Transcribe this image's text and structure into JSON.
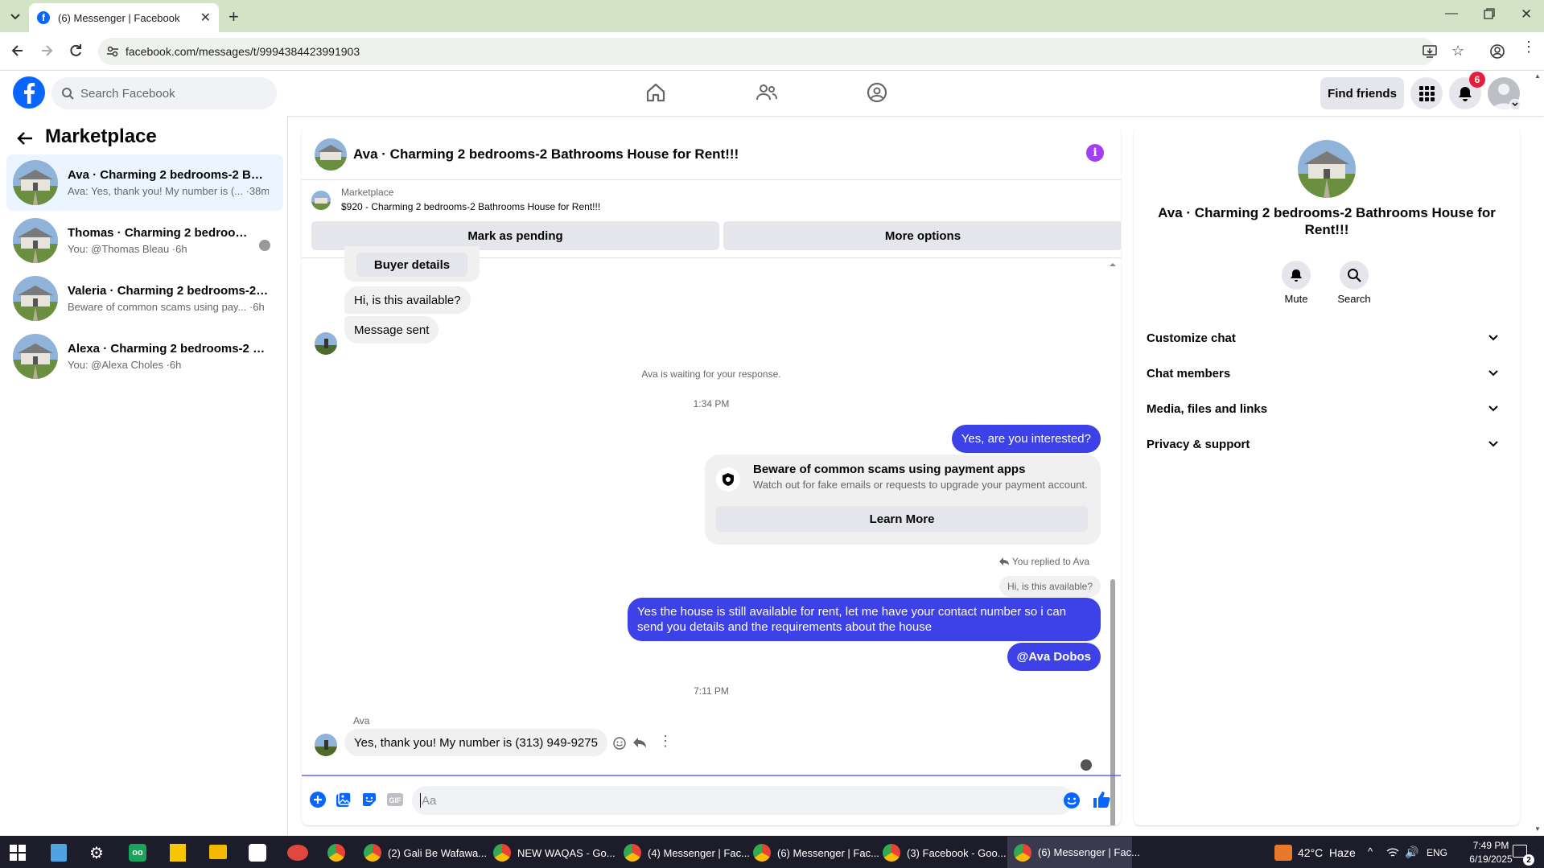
{
  "browser": {
    "tab_title": "(6) Messenger | Facebook",
    "url": "facebook.com/messages/t/9994384423991903"
  },
  "fb_header": {
    "search_placeholder": "Search Facebook",
    "find_friends": "Find friends",
    "notification_count": "6"
  },
  "sidebar": {
    "title": "Marketplace",
    "conversations": [
      {
        "title": "Ava · Charming 2 bedrooms-2 Bat...",
        "preview": "Ava: Yes, thank you! My number is (... ·38m"
      },
      {
        "title": "Thomas · Charming 2 bedrooms...",
        "preview": "You: @Thomas Bleau ·6h"
      },
      {
        "title": "Valeria · Charming 2 bedrooms-2 ...",
        "preview": "Beware of common scams using pay... ·6h"
      },
      {
        "title": "Alexa · Charming 2 bedrooms-2 B...",
        "preview": "You: @Alexa Choles ·6h"
      }
    ]
  },
  "chat": {
    "header_title": "Ava · Charming 2 bedrooms-2 Bathrooms House for Rent!!!",
    "listing_label": "Marketplace",
    "listing_text": "$920 - Charming 2 bedrooms-2 Bathrooms House for Rent!!!",
    "mark_pending": "Mark as pending",
    "more_options": "More options",
    "buyer_details": "Buyer details",
    "msg_available": "Hi, is this available?",
    "msg_sent": "Message sent",
    "waiting": "Ava is waiting for your response.",
    "time1": "1:34 PM",
    "msg_interested": "Yes, are you interested?",
    "scam_title": "Beware of common scams using payment apps",
    "scam_sub": "Watch out for fake emails or requests to upgrade your payment account.",
    "learn_more": "Learn More",
    "replied_to": "You replied to Ava",
    "quoted": "Hi, is this available?",
    "msg_long": "Yes the house is still available for rent, let me have your contact number so i can send you details and the requirements about the house",
    "msg_mention": "@Ava Dobos",
    "time2": "7:11 PM",
    "sender_name": "Ava",
    "msg_number": "Yes, thank you! My number is (313) 949-9275",
    "composer_placeholder": "Aa"
  },
  "right_panel": {
    "title": "Ava · Charming 2 bedrooms-2 Bathrooms House for Rent!!!",
    "mute": "Mute",
    "search": "Search",
    "sections": [
      "Customize chat",
      "Chat members",
      "Media, files and links",
      "Privacy & support"
    ]
  },
  "taskbar": {
    "items": [
      "(2) Gali Be Wafawa...",
      "NEW WAQAS - Go...",
      "(4) Messenger | Fac...",
      "(6) Messenger | Fac...",
      "(3) Facebook - Goo...",
      "(6) Messenger | Fac..."
    ],
    "weather": "42°C  Haze",
    "lang": "ENG",
    "time": "7:49 PM",
    "date": "6/19/2025",
    "notif_badge": "2"
  },
  "colors": {
    "accent": "#3c41e8",
    "fb_blue": "#0866ff",
    "info_purple": "#a33ef2"
  }
}
